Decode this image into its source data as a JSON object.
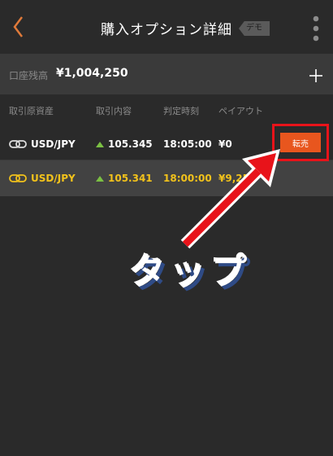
{
  "header": {
    "title": "購入オプション詳細",
    "demo_tag": "デモ",
    "back_icon": "chevron-left-icon",
    "more_icon": "vertical-dots-icon"
  },
  "balance": {
    "label": "口座残高",
    "value": "¥1,004,250",
    "add_icon": "plus-icon"
  },
  "table": {
    "headers": [
      "取引原資産",
      "取引内容",
      "判定時刻",
      "ペイアウト"
    ],
    "rows": [
      {
        "asset": "USD/JPY",
        "rate": "105.345",
        "time": "18:05:00",
        "payout": "¥0",
        "action": "転売",
        "text_color": "#ffffff"
      },
      {
        "asset": "USD/JPY",
        "rate": "105.341",
        "time": "18:00:00",
        "payout": "¥9,25",
        "text_color": "#f2c21b"
      }
    ]
  },
  "annotation": {
    "text": "タップ",
    "highlight_color": "#e8131a"
  },
  "colors": {
    "accent_orange": "#e8561e",
    "gold": "#f2c21b",
    "up_green": "#7bc043"
  }
}
